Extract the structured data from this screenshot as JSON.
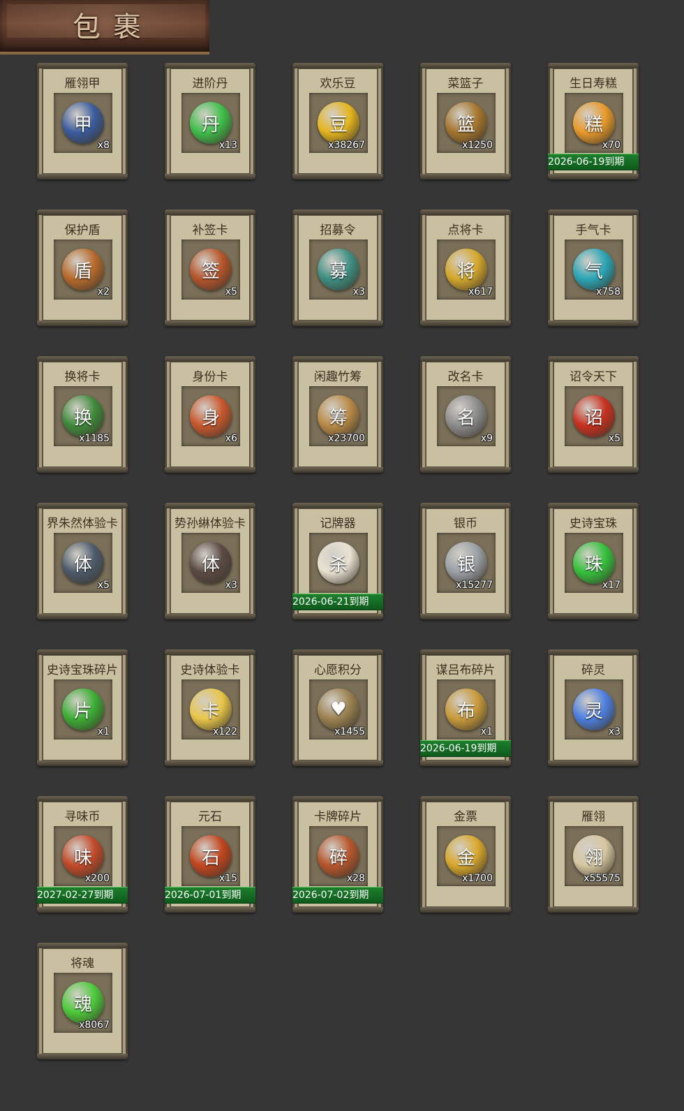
{
  "title": "包裹",
  "items": [
    {
      "name": "雁翎甲",
      "count": "x8",
      "icon": "armor-icon",
      "color": "#3a5b9c",
      "glyph": "甲"
    },
    {
      "name": "进阶丹",
      "count": "x13",
      "icon": "green-pill-icon",
      "color": "#3fbf4a",
      "glyph": "丹"
    },
    {
      "name": "欢乐豆",
      "count": "x38267",
      "icon": "gold-beans-icon",
      "color": "#e6b51e",
      "glyph": "豆"
    },
    {
      "name": "菜篮子",
      "count": "x1250",
      "icon": "basket-icon",
      "color": "#a6762e",
      "glyph": "篮"
    },
    {
      "name": "生日寿糕",
      "count": "x70",
      "icon": "cake-icon",
      "color": "#e99a2a",
      "glyph": "糕",
      "expiry": "2026-06-19到期"
    },
    {
      "name": "保护盾",
      "count": "x2",
      "icon": "shield-icon",
      "color": "#b86a2c",
      "glyph": "盾"
    },
    {
      "name": "补签卡",
      "count": "x5",
      "icon": "sign-card-icon",
      "color": "#b5552a",
      "glyph": "签"
    },
    {
      "name": "招募令",
      "count": "x3",
      "icon": "recruit-token-icon",
      "color": "#3e8f84",
      "glyph": "募"
    },
    {
      "name": "点将卡",
      "count": "x617",
      "icon": "general-card-icon",
      "color": "#d4a72c",
      "glyph": "将"
    },
    {
      "name": "手气卡",
      "count": "x758",
      "icon": "luck-card-icon",
      "color": "#2aa5b5",
      "glyph": "气"
    },
    {
      "name": "换将卡",
      "count": "x1185",
      "icon": "swap-card-icon",
      "color": "#3f8a3b",
      "glyph": "换"
    },
    {
      "name": "身份卡",
      "count": "x6",
      "icon": "mask-card-icon",
      "color": "#c8582d",
      "glyph": "身"
    },
    {
      "name": "闲趣竹筹",
      "count": "x23700",
      "icon": "bamboo-token-icon",
      "color": "#b98a47",
      "glyph": "筹"
    },
    {
      "name": "改名卡",
      "count": "x9",
      "icon": "rename-card-icon",
      "color": "#8c8c8c",
      "glyph": "名"
    },
    {
      "name": "诏令天下",
      "count": "x5",
      "icon": "edict-scroll-icon",
      "color": "#c9301f",
      "glyph": "诏"
    },
    {
      "name": "界朱然体验卡",
      "count": "x5",
      "icon": "hero-portrait-icon",
      "color": "#4c5a6b",
      "glyph": "体"
    },
    {
      "name": "势孙綝体验卡",
      "count": "x3",
      "icon": "hero-portrait-icon",
      "color": "#5a4a44",
      "glyph": "体"
    },
    {
      "name": "记牌器",
      "count": "",
      "icon": "playing-cards-icon",
      "color": "#e8e2d2",
      "glyph": "杀",
      "expiry": "2026-06-21到期"
    },
    {
      "name": "银币",
      "count": "x15277",
      "icon": "silver-coin-icon",
      "color": "#9aa0a6",
      "glyph": "银"
    },
    {
      "name": "史诗宝珠",
      "count": "x17",
      "icon": "green-orb-icon",
      "color": "#34c23c",
      "glyph": "珠"
    },
    {
      "name": "史诗宝珠碎片",
      "count": "x1",
      "icon": "green-shard-icon",
      "color": "#3cae35",
      "glyph": "片"
    },
    {
      "name": "史诗体验卡",
      "count": "x122",
      "icon": "gold-card-icon",
      "color": "#e8c649",
      "glyph": "卡"
    },
    {
      "name": "心愿积分",
      "count": "x1455",
      "icon": "heart-coin-icon",
      "color": "#9b8151",
      "glyph": "♥"
    },
    {
      "name": "谋吕布碎片",
      "count": "x1",
      "icon": "puzzle-hero-icon",
      "color": "#c99a3c",
      "glyph": "布",
      "expiry": "2026-06-19到期"
    },
    {
      "name": "碎灵",
      "count": "x3",
      "icon": "blue-crystal-icon",
      "color": "#4d7fe0",
      "glyph": "灵"
    },
    {
      "name": "寻味币",
      "count": "x200",
      "icon": "flavor-coin-icon",
      "color": "#c24a2a",
      "glyph": "味",
      "expiry": "2027-02-27到期"
    },
    {
      "name": "元石",
      "count": "x15",
      "icon": "fire-stone-icon",
      "color": "#c2451f",
      "glyph": "石",
      "expiry": "2026-07-01到期"
    },
    {
      "name": "卡牌碎片",
      "count": "x28",
      "icon": "puzzle-piece-icon",
      "color": "#b7562c",
      "glyph": "碎",
      "expiry": "2026-07-02到期"
    },
    {
      "name": "金票",
      "count": "x1700",
      "icon": "gold-ticket-icon",
      "color": "#d9a82c",
      "glyph": "金"
    },
    {
      "name": "雁翎",
      "count": "x55575",
      "icon": "feather-icon",
      "color": "#d6c7a0",
      "glyph": "翎"
    },
    {
      "name": "将魂",
      "count": "x8067",
      "icon": "green-spirit-icon",
      "color": "#4ccb3a",
      "glyph": "魂"
    }
  ]
}
